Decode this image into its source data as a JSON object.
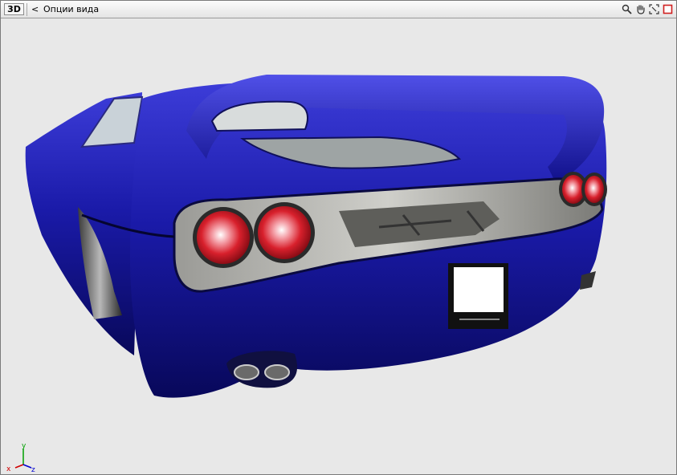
{
  "toolbar": {
    "mode_label": "3D",
    "back_label": "<",
    "title": "Опции вида",
    "tools": [
      {
        "name": "zoom-icon"
      },
      {
        "name": "pan-hand-icon"
      },
      {
        "name": "fit-view-icon"
      },
      {
        "name": "stop-icon"
      }
    ]
  },
  "axis": {
    "x_label": "x",
    "y_label": "y",
    "z_label": "z",
    "colors": {
      "x": "#d00000",
      "y": "#00a000",
      "z": "#0000d0"
    }
  },
  "scene": {
    "body_color": "#1a1aa8",
    "light_color": "#e0202a"
  }
}
